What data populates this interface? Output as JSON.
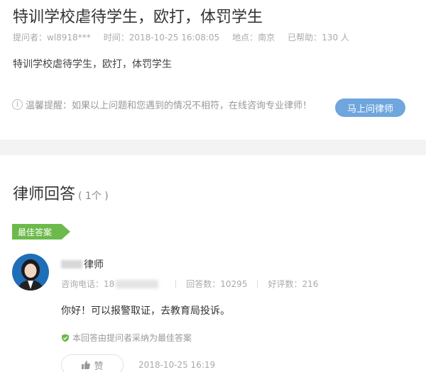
{
  "question": {
    "title": "特训学校虐待学生，欧打，体罚学生",
    "asker": "提问者：wl8918***",
    "time": "时间：2018-10-25 16:08:05",
    "location": "地点：南京",
    "helped": "已帮助：130 人",
    "body": "特训学校虐待学生，欧打，体罚学生"
  },
  "reminder": {
    "text": "温馨提醒：如果以上问题和您遇到的情况不相符，在线咨询专业律师！",
    "button_label": "马上问律师"
  },
  "answers": {
    "title": "律师回答",
    "count": "( 1个 )",
    "best_badge": "最佳答案"
  },
  "lawyer": {
    "name_suffix": "律师",
    "phone_label": "咨询电话：18",
    "answers_count": "回答数：10295",
    "rating_count": "好评数：216"
  },
  "answer": {
    "text": "你好！可以报警取证，去教育局投诉。",
    "adopted_note": "本回答由提问者采纳为最佳答案",
    "like_label": "赞",
    "time": "2018-10-25 16:19"
  },
  "colors": {
    "accent_blue": "#6ea6dd",
    "best_green": "#6cba4b",
    "divider_gray": "#f3f3f3"
  },
  "icons": [
    "info-icon",
    "shield-check-icon",
    "thumbs-up-icon"
  ]
}
